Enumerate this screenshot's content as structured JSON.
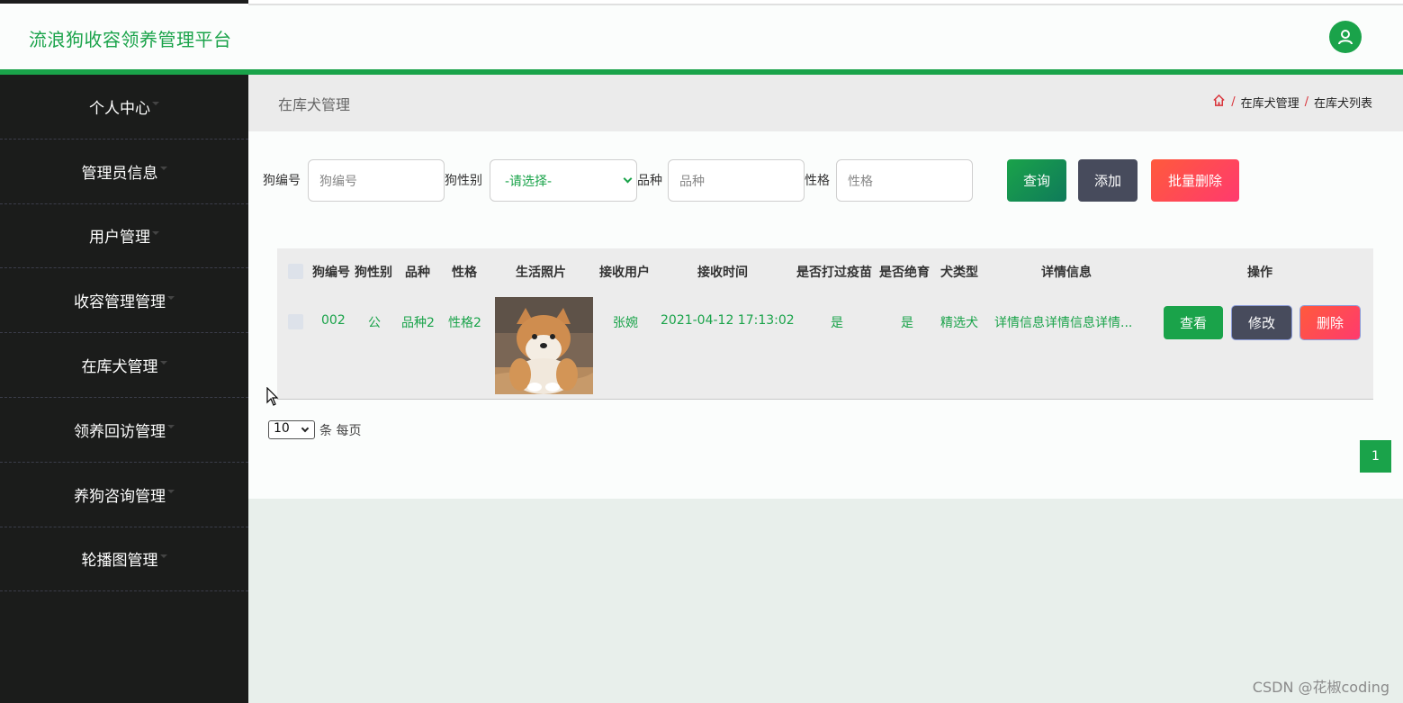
{
  "app": {
    "title": "流浪狗收容领养管理平台"
  },
  "sidebar": {
    "items": [
      {
        "label": "个人中心"
      },
      {
        "label": "管理员信息"
      },
      {
        "label": "用户管理"
      },
      {
        "label": "收容管理管理"
      },
      {
        "label": "在库犬管理"
      },
      {
        "label": "领养回访管理"
      },
      {
        "label": "养狗咨询管理"
      },
      {
        "label": "轮播图管理"
      }
    ]
  },
  "page": {
    "title": "在库犬管理",
    "breadcrumb": [
      "在库犬管理",
      "在库犬列表"
    ]
  },
  "search": {
    "dog_no_label": "狗编号",
    "dog_no_placeholder": "狗编号",
    "gender_label": "狗性别",
    "gender_selected": "-请选择-",
    "breed_label": "品种",
    "breed_placeholder": "品种",
    "temper_label": "性格",
    "temper_placeholder": "性格",
    "query_label": "查询",
    "add_label": "添加",
    "batch_delete_label": "批量删除"
  },
  "table": {
    "columns": [
      "狗编号",
      "狗性别",
      "品种",
      "性格",
      "生活照片",
      "接收用户",
      "接收时间",
      "是否打过疫苗",
      "是否绝育",
      "犬类型",
      "详情信息",
      "操作"
    ],
    "rows": [
      {
        "dog_no": "002",
        "gender": "公",
        "breed": "品种2",
        "temper": "性格2",
        "user": "张婉",
        "time": "2021-04-12 17:13:02",
        "vaccinated": "是",
        "neutered": "是",
        "type": "精选犬",
        "detail": "详情信息详情信息详情...",
        "view_label": "查看",
        "edit_label": "修改",
        "delete_label": "删除"
      }
    ]
  },
  "pagination": {
    "page_size": "10",
    "per_page_text": "条 每页",
    "current_page": "1"
  },
  "watermark": "CSDN @花椒coding",
  "colors": {
    "brand_green": "#1aa34a",
    "sidebar_bg": "#1b1c1b",
    "danger": "#ff4757",
    "dark_button": "#474b5c"
  }
}
